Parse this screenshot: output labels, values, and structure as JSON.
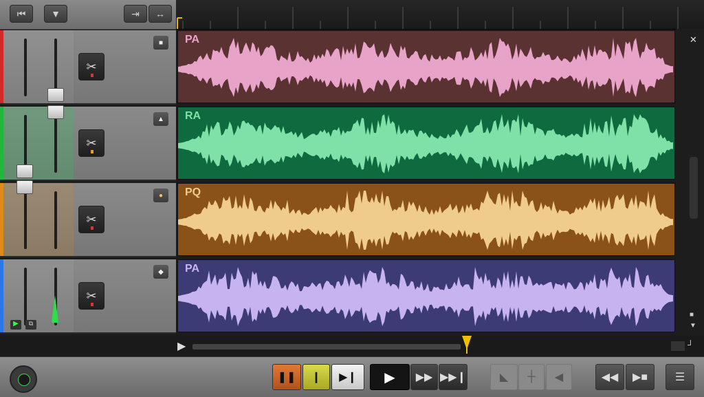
{
  "toolbar": {
    "icons": [
      "rewind-to-start-icon",
      "triangle-down-icon",
      "send-icon",
      "split-icon"
    ]
  },
  "tracks": [
    {
      "label": "PA",
      "color": "#e8a3c9",
      "bg": "#5a3232",
      "accent": "#d22a2a",
      "button_icon": "stop-square-icon"
    },
    {
      "label": "RA",
      "color": "#7fe0a8",
      "bg": "#0f6b3f",
      "accent": "#1fb83c",
      "button_icon": "bell-icon"
    },
    {
      "label": "PQ",
      "color": "#f0cc8c",
      "bg": "#8a5218",
      "accent": "#e08a17",
      "button_icon": "circle-icon"
    },
    {
      "label": "PA",
      "color": "#c7b3f0",
      "bg": "#3d3b75",
      "accent": "#2a78e8",
      "button_icon": "diamond-icon"
    }
  ],
  "transport": {
    "icons": [
      "pause-icon",
      "stop-bar-icon",
      "step-forward-icon",
      "play-icon",
      "fast-forward-icon",
      "skip-end-icon",
      "marker-icon",
      "line-icon",
      "back-icon",
      "rewind-icon",
      "forward-icon",
      "list-icon"
    ]
  },
  "colors": {
    "pause_bg": "#c8682a",
    "stop_bg": "#c9c93a",
    "play_bg": "#1f1f1f"
  },
  "playhead_position": 0.53
}
